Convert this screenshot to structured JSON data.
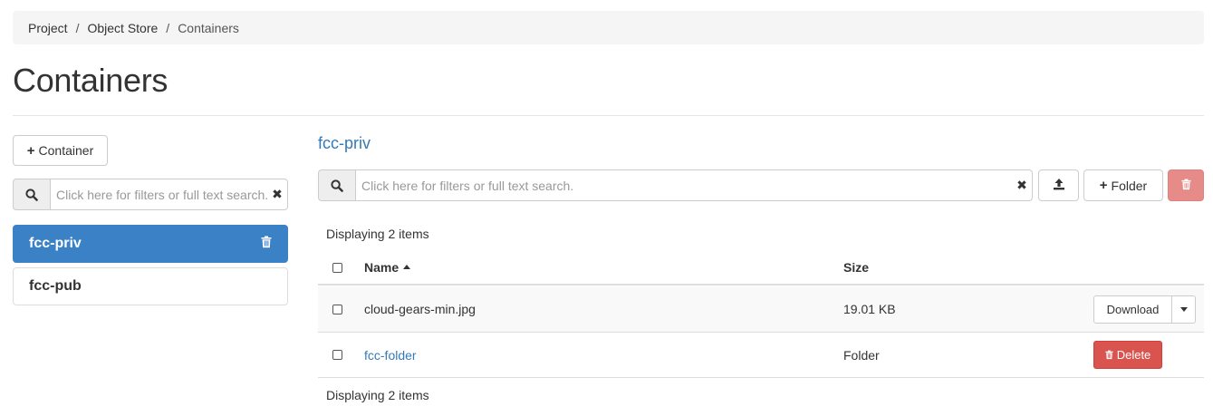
{
  "breadcrumb": {
    "items": [
      "Project",
      "Object Store",
      "Containers"
    ],
    "separator": "/"
  },
  "page": {
    "title": "Containers"
  },
  "sidebar": {
    "add_container_label": "Container",
    "search": {
      "placeholder": "Click here for filters or full text search.",
      "value": ""
    },
    "containers": [
      {
        "name": "fcc-priv",
        "active": true
      },
      {
        "name": "fcc-pub",
        "active": false
      }
    ]
  },
  "main": {
    "container_name": "fcc-priv",
    "search": {
      "placeholder": "Click here for filters or full text search.",
      "value": ""
    },
    "folder_button_label": "Folder",
    "display_count_top": "Displaying 2 items",
    "display_count_bottom": "Displaying 2 items",
    "table": {
      "columns": {
        "name": "Name",
        "size": "Size"
      },
      "sort": {
        "column": "Name",
        "direction": "ascending"
      },
      "rows": [
        {
          "name": "cloud-gears-min.jpg",
          "size": "19.01 KB",
          "kind": "file",
          "action": "Download"
        },
        {
          "name": "fcc-folder",
          "size": "Folder",
          "kind": "folder",
          "action": "Delete"
        }
      ]
    }
  },
  "icons": {
    "search": "search-icon",
    "clear": "clear-icon",
    "trash": "trash-icon",
    "upload": "upload-icon",
    "plus": "plus-icon",
    "caret_down": "chevron-down-icon",
    "sort_up": "sort-ascending-icon"
  },
  "colors": {
    "primary": "#3a81c5",
    "link": "#337ab7",
    "danger": "#d9534f",
    "danger_disabled": "#e78b89",
    "breadcrumb_bg": "#f5f5f5"
  }
}
